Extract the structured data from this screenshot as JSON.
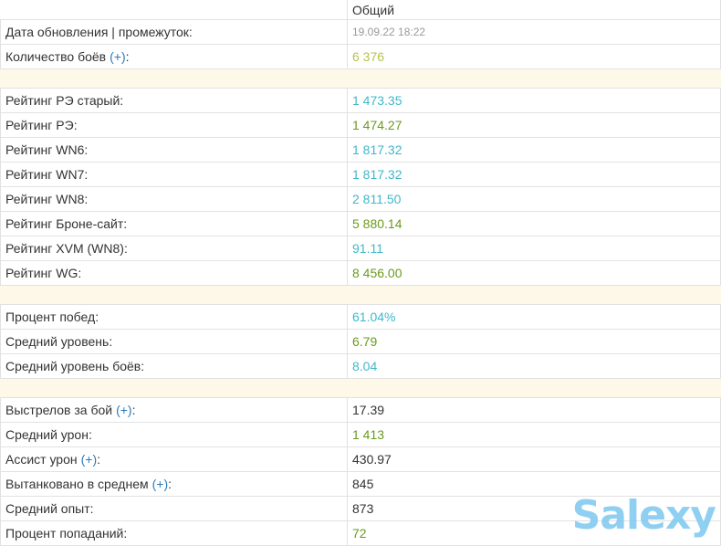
{
  "header": {
    "column": "Общий"
  },
  "meta": [
    {
      "label": "Дата обновления | промежуток:",
      "value": "19.09.22 18:22",
      "plus": "",
      "color": "small"
    },
    {
      "label": "Количество боёв",
      "value": "6 376",
      "plus": "(+)",
      "suffix": ":",
      "color": "c-yellow"
    }
  ],
  "ratings": [
    {
      "label": "Рейтинг РЭ старый:",
      "value": "1 473.35",
      "color": "c-cyan"
    },
    {
      "label": "Рейтинг РЭ:",
      "value": "1 474.27",
      "color": "c-green"
    },
    {
      "label": "Рейтинг WN6:",
      "value": "1 817.32",
      "color": "c-cyan"
    },
    {
      "label": "Рейтинг WN7:",
      "value": "1 817.32",
      "color": "c-cyan"
    },
    {
      "label": "Рейтинг WN8:",
      "value": "2 811.50",
      "color": "c-cyan"
    },
    {
      "label": "Рейтинг Броне-сайт:",
      "value": "5 880.14",
      "color": "c-green"
    },
    {
      "label": "Рейтинг XVM (WN8):",
      "value": "91.11",
      "color": "c-cyan"
    },
    {
      "label": "Рейтинг WG:",
      "value": "8 456.00",
      "color": "c-green"
    }
  ],
  "general": [
    {
      "label": "Процент побед:",
      "value": "61.04%",
      "color": "c-cyan"
    },
    {
      "label": "Средний уровень:",
      "value": "6.79",
      "color": "c-green"
    },
    {
      "label": "Средний уровень боёв:",
      "value": "8.04",
      "color": "c-cyan"
    }
  ],
  "combat": [
    {
      "label": "Выстрелов за бой",
      "plus": "(+)",
      "suffix": ":",
      "value": "17.39",
      "color": "c-dark"
    },
    {
      "label": "Средний урон:",
      "plus": "",
      "suffix": "",
      "value": "1 413",
      "color": "c-green"
    },
    {
      "label": "Ассист урон",
      "plus": "(+)",
      "suffix": ":",
      "value": "430.97",
      "color": "c-dark"
    },
    {
      "label": "Вытанковано в среднем",
      "plus": "(+)",
      "suffix": ":",
      "value": "845",
      "color": "c-dark"
    },
    {
      "label": "Средний опыт:",
      "plus": "",
      "suffix": "",
      "value": "873",
      "color": "c-dark"
    },
    {
      "label": "Процент попаданий:",
      "plus": "",
      "suffix": "",
      "value": "72",
      "color": "c-green"
    }
  ],
  "watermark": "Salexy"
}
